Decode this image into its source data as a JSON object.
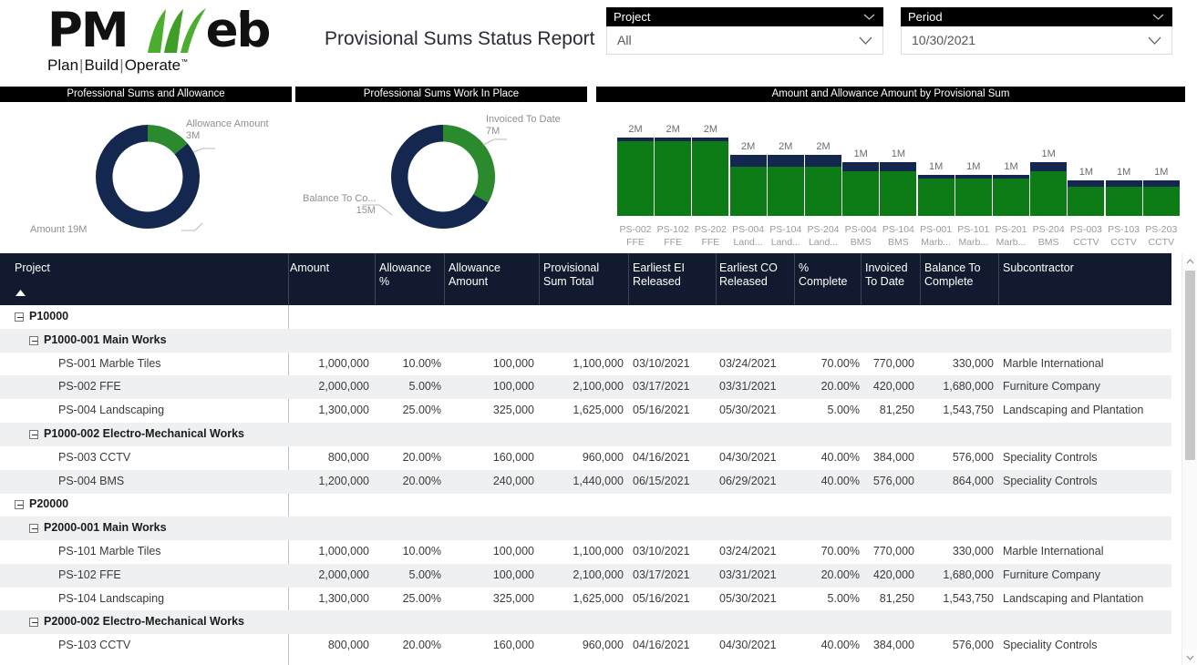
{
  "header": {
    "logo_main": "PM",
    "logo_rest": "eb",
    "logo_reg": "®",
    "tagline_plan": "Plan",
    "tagline_build": "Build",
    "tagline_operate": "Operate",
    "tagline_tm": "™",
    "report_title": "Provisional Sums Status Report"
  },
  "slicers": [
    {
      "name": "project",
      "label": "Project",
      "value": "All",
      "icon": "chevron-down-icon"
    },
    {
      "name": "period",
      "label": "Period",
      "value": "10/30/2021",
      "icon": "chevron-down-icon"
    }
  ],
  "panels": {
    "donut1_title": "Professional Sums and Allowance",
    "donut2_title": "Professional Sums Work In Place",
    "bars_title": "Amount and Allowance Amount by Provisional Sum"
  },
  "colors": {
    "navy": "#13274f",
    "green": "#2b8a2e",
    "bar_green": "#0d7c16",
    "bar_navy": "#13274f",
    "header_bg": "#111a2e",
    "panel_bg": "#000000"
  },
  "chart_data": [
    {
      "type": "pie",
      "title": "Professional Sums and Allowance",
      "labels": [
        "Amount",
        "Allowance Amount"
      ],
      "value_labels": [
        "Amount 19M",
        "Allowance Amount\n3M"
      ],
      "values": [
        19,
        3
      ],
      "units": "M",
      "colors": [
        "#13274f",
        "#2b8a2e"
      ],
      "legend": "none",
      "donut": true
    },
    {
      "type": "pie",
      "title": "Professional Sums Work In Place",
      "labels": [
        "Balance To Co...",
        "Invoiced To Date"
      ],
      "value_labels": [
        "Balance To Co...\n15M",
        "Invoiced To Date\n7M"
      ],
      "values": [
        15,
        7
      ],
      "units": "M",
      "colors": [
        "#13274f",
        "#2b8a2e"
      ],
      "legend": "none",
      "donut": true
    },
    {
      "type": "bar",
      "title": "Amount and Allowance Amount by Provisional Sum",
      "stacked": true,
      "xlabel": "",
      "ylabel": "",
      "categories": [
        "PS-002\nFFE",
        "PS-102\nFFE",
        "PS-202\nFFE",
        "PS-004\nLand...",
        "PS-104\nLand...",
        "PS-204\nLand...",
        "PS-004\nBMS",
        "PS-104\nBMS",
        "PS-001\nMarb...",
        "PS-101\nMarb...",
        "PS-201\nMarb...",
        "PS-204\nBMS",
        "PS-003\nCCTV",
        "PS-103\nCCTV",
        "PS-203\nCCTV"
      ],
      "data_labels": [
        "2M",
        "2M",
        "2M",
        "2M",
        "2M",
        "2M",
        "1M",
        "1M",
        "1M",
        "1M",
        "1M",
        "1M",
        "1M",
        "1M",
        "1M"
      ],
      "series": [
        {
          "name": "Amount",
          "color": "#0d7c16",
          "values": [
            2000000,
            2000000,
            2000000,
            1300000,
            1300000,
            1300000,
            1200000,
            1200000,
            1000000,
            1000000,
            1000000,
            1200000,
            800000,
            800000,
            800000
          ]
        },
        {
          "name": "Allowance Amount",
          "color": "#13274f",
          "values": [
            100000,
            100000,
            100000,
            325000,
            325000,
            325000,
            240000,
            240000,
            100000,
            100000,
            100000,
            240000,
            160000,
            160000,
            160000
          ]
        }
      ]
    }
  ],
  "table": {
    "columns": [
      {
        "key": "project",
        "label": "Project",
        "align": "left"
      },
      {
        "key": "amount",
        "label": "Amount",
        "align": "right"
      },
      {
        "key": "allow_pct",
        "label": "Allowance\n%",
        "align": "right"
      },
      {
        "key": "allow_amt",
        "label": "Allowance\nAmount",
        "align": "right"
      },
      {
        "key": "ps_total",
        "label": "Provisional\nSum Total",
        "align": "right"
      },
      {
        "key": "ei_rel",
        "label": "Earliest EI\nReleased",
        "align": "left"
      },
      {
        "key": "co_rel",
        "label": "Earliest CO\nReleased",
        "align": "left"
      },
      {
        "key": "pct_comp",
        "label": "%\nComplete",
        "align": "right"
      },
      {
        "key": "invoiced",
        "label": "Invoiced\nTo Date",
        "align": "right"
      },
      {
        "key": "balance",
        "label": "Balance To\nComplete",
        "align": "right"
      },
      {
        "key": "subcontractor",
        "label": "Subcontractor",
        "align": "left"
      }
    ],
    "sort": {
      "column": "Project",
      "direction": "ascending",
      "icon": "sort-asc-icon"
    },
    "rows": [
      {
        "level": 0,
        "expander": "collapse-icon",
        "project": "P10000",
        "bold": true,
        "amount": "",
        "allow_pct": "",
        "allow_amt": "",
        "ps_total": "",
        "ei_rel": "",
        "co_rel": "",
        "pct_comp": "",
        "invoiced": "",
        "balance": "",
        "subcontractor": ""
      },
      {
        "level": 1,
        "expander": "collapse-icon",
        "project": "P1000-001 Main Works",
        "bold": true,
        "amount": "",
        "allow_pct": "",
        "allow_amt": "",
        "ps_total": "",
        "ei_rel": "",
        "co_rel": "",
        "pct_comp": "",
        "invoiced": "",
        "balance": "",
        "subcontractor": ""
      },
      {
        "level": 2,
        "project": "PS-001 Marble Tiles",
        "amount": "1,000,000",
        "allow_pct": "10.00%",
        "allow_amt": "100,000",
        "ps_total": "1,100,000",
        "ei_rel": "03/10/2021",
        "co_rel": "03/24/2021",
        "pct_comp": "70.00%",
        "invoiced": "770,000",
        "balance": "330,000",
        "subcontractor": "Marble International"
      },
      {
        "level": 2,
        "project": "PS-002 FFE",
        "amount": "2,000,000",
        "allow_pct": "5.00%",
        "allow_amt": "100,000",
        "ps_total": "2,100,000",
        "ei_rel": "03/17/2021",
        "co_rel": "03/31/2021",
        "pct_comp": "20.00%",
        "invoiced": "420,000",
        "balance": "1,680,000",
        "subcontractor": "Furniture Company"
      },
      {
        "level": 2,
        "project": "PS-004 Landscaping",
        "amount": "1,300,000",
        "allow_pct": "25.00%",
        "allow_amt": "325,000",
        "ps_total": "1,625,000",
        "ei_rel": "05/16/2021",
        "co_rel": "05/30/2021",
        "pct_comp": "5.00%",
        "invoiced": "81,250",
        "balance": "1,543,750",
        "subcontractor": "Landscaping and Plantation"
      },
      {
        "level": 1,
        "expander": "collapse-icon",
        "project": "P1000-002 Electro-Mechanical Works",
        "bold": true,
        "amount": "",
        "allow_pct": "",
        "allow_amt": "",
        "ps_total": "",
        "ei_rel": "",
        "co_rel": "",
        "pct_comp": "",
        "invoiced": "",
        "balance": "",
        "subcontractor": ""
      },
      {
        "level": 2,
        "project": "PS-003 CCTV",
        "amount": "800,000",
        "allow_pct": "20.00%",
        "allow_amt": "160,000",
        "ps_total": "960,000",
        "ei_rel": "04/16/2021",
        "co_rel": "04/30/2021",
        "pct_comp": "40.00%",
        "invoiced": "384,000",
        "balance": "576,000",
        "subcontractor": "Speciality Controls"
      },
      {
        "level": 2,
        "project": "PS-004 BMS",
        "amount": "1,200,000",
        "allow_pct": "20.00%",
        "allow_amt": "240,000",
        "ps_total": "1,440,000",
        "ei_rel": "06/15/2021",
        "co_rel": "06/29/2021",
        "pct_comp": "40.00%",
        "invoiced": "576,000",
        "balance": "864,000",
        "subcontractor": "Speciality Controls"
      },
      {
        "level": 0,
        "expander": "collapse-icon",
        "project": "P20000",
        "bold": true,
        "amount": "",
        "allow_pct": "",
        "allow_amt": "",
        "ps_total": "",
        "ei_rel": "",
        "co_rel": "",
        "pct_comp": "",
        "invoiced": "",
        "balance": "",
        "subcontractor": ""
      },
      {
        "level": 1,
        "expander": "collapse-icon",
        "project": "P2000-001 Main Works",
        "bold": true,
        "amount": "",
        "allow_pct": "",
        "allow_amt": "",
        "ps_total": "",
        "ei_rel": "",
        "co_rel": "",
        "pct_comp": "",
        "invoiced": "",
        "balance": "",
        "subcontractor": ""
      },
      {
        "level": 2,
        "project": "PS-101 Marble Tiles",
        "amount": "1,000,000",
        "allow_pct": "10.00%",
        "allow_amt": "100,000",
        "ps_total": "1,100,000",
        "ei_rel": "03/10/2021",
        "co_rel": "03/24/2021",
        "pct_comp": "70.00%",
        "invoiced": "770,000",
        "balance": "330,000",
        "subcontractor": "Marble International"
      },
      {
        "level": 2,
        "project": "PS-102 FFE",
        "amount": "2,000,000",
        "allow_pct": "5.00%",
        "allow_amt": "100,000",
        "ps_total": "2,100,000",
        "ei_rel": "03/17/2021",
        "co_rel": "03/31/2021",
        "pct_comp": "20.00%",
        "invoiced": "420,000",
        "balance": "1,680,000",
        "subcontractor": "Furniture Company"
      },
      {
        "level": 2,
        "project": "PS-104 Landscaping",
        "amount": "1,300,000",
        "allow_pct": "25.00%",
        "allow_amt": "325,000",
        "ps_total": "1,625,000",
        "ei_rel": "05/16/2021",
        "co_rel": "05/30/2021",
        "pct_comp": "5.00%",
        "invoiced": "81,250",
        "balance": "1,543,750",
        "subcontractor": "Landscaping and Plantation"
      },
      {
        "level": 1,
        "expander": "collapse-icon",
        "project": "P2000-002 Electro-Mechanical Works",
        "bold": true,
        "amount": "",
        "allow_pct": "",
        "allow_amt": "",
        "ps_total": "",
        "ei_rel": "",
        "co_rel": "",
        "pct_comp": "",
        "invoiced": "",
        "balance": "",
        "subcontractor": ""
      },
      {
        "level": 2,
        "project": "PS-103 CCTV",
        "amount": "800,000",
        "allow_pct": "20.00%",
        "allow_amt": "160,000",
        "ps_total": "960,000",
        "ei_rel": "04/16/2021",
        "co_rel": "04/30/2021",
        "pct_comp": "40.00%",
        "invoiced": "384,000",
        "balance": "576,000",
        "subcontractor": "Speciality Controls"
      }
    ]
  },
  "scrollbar": {
    "up_icon": "chevron-up-icon",
    "down_icon": "chevron-down-icon"
  }
}
